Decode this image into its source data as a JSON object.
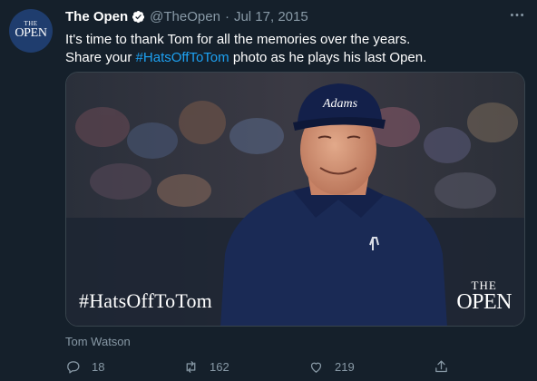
{
  "tweet": {
    "author_name": "The Open",
    "handle": "@TheOpen",
    "separator": "·",
    "date": "Jul 17, 2015",
    "text_line1": "It's time to thank Tom for all the memories over the years.",
    "text_line2_prefix": "Share your ",
    "hashtag": "#HatsOffToTom",
    "text_line2_suffix": " photo as he plays his last Open.",
    "media": {
      "overlay_hashtag": "#HatsOffToTom",
      "logo_line1": "THE",
      "logo_line2": "OPEN",
      "cap_text": "Adams"
    },
    "alt_caption": "Tom Watson",
    "actions": {
      "replies": "18",
      "retweets": "162",
      "likes": "219"
    }
  },
  "avatar": {
    "line1": "THE",
    "line2": "OPEN"
  },
  "colors": {
    "background": "#15202b",
    "secondary_text": "#8899a6",
    "accent": "#1da1f2"
  },
  "icons": [
    "verified-badge-icon",
    "more-icon",
    "reply-icon",
    "retweet-icon",
    "like-icon",
    "share-icon"
  ]
}
